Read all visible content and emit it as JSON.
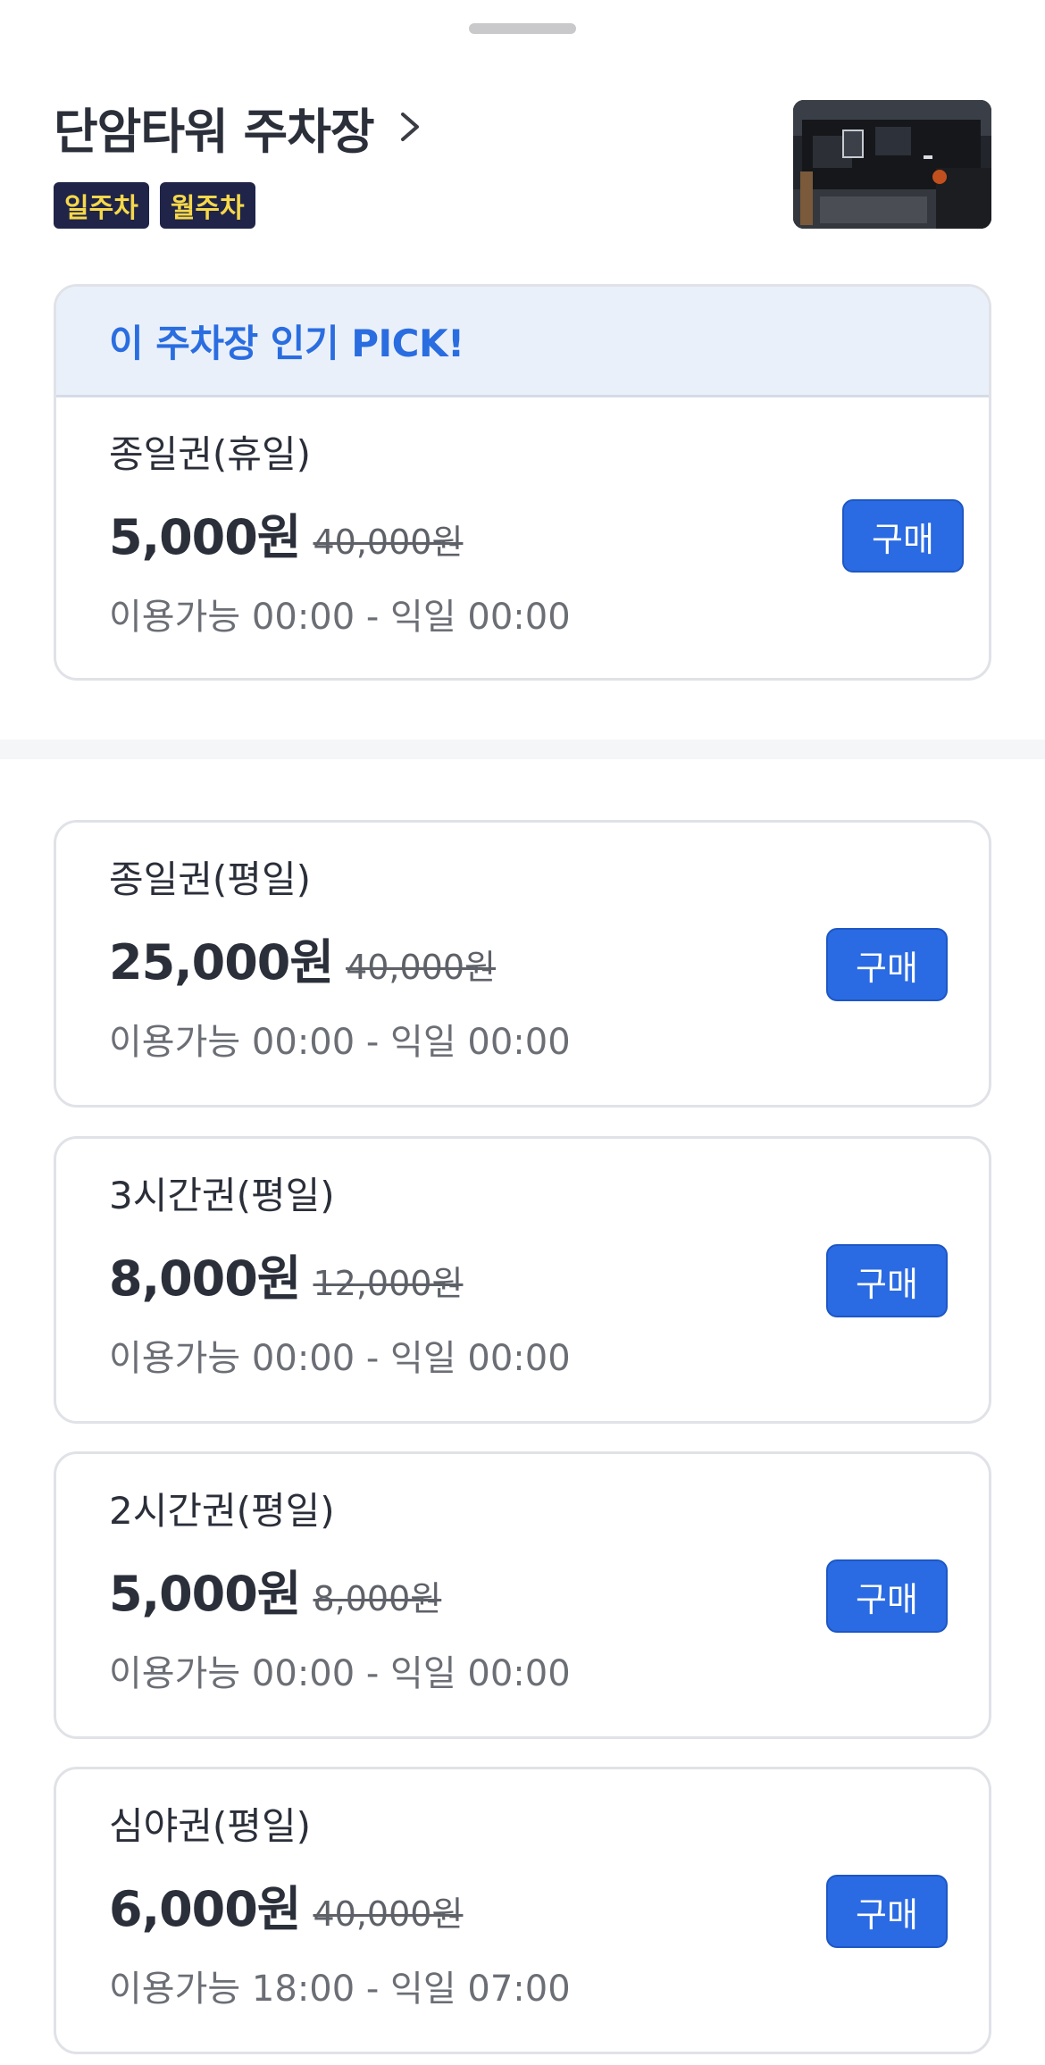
{
  "lot": {
    "title": "단암타워 주차장",
    "tags": [
      "일주차",
      "월주차"
    ]
  },
  "pick": {
    "header": "이 주차장 인기 PICK!",
    "ticket": {
      "name": "종일권(휴일)",
      "price": "5,000원",
      "original_price": "40,000원",
      "hours": "이용가능 00:00 - 익일 00:00",
      "button": "구매"
    }
  },
  "tickets": [
    {
      "name": "종일권(평일)",
      "price": "25,000원",
      "original_price": "40,000원",
      "hours": "이용가능 00:00 - 익일 00:00",
      "button": "구매"
    },
    {
      "name": "3시간권(평일)",
      "price": "8,000원",
      "original_price": "12,000원",
      "hours": "이용가능 00:00 - 익일 00:00",
      "button": "구매"
    },
    {
      "name": "2시간권(평일)",
      "price": "5,000원",
      "original_price": "8,000원",
      "hours": "이용가능 00:00 - 익일 00:00",
      "button": "구매"
    },
    {
      "name": "심야권(평일)",
      "price": "6,000원",
      "original_price": "40,000원",
      "hours": "이용가능 18:00 - 익일 07:00",
      "button": "구매"
    }
  ],
  "colors": {
    "accent": "#2a6ae2",
    "tag_bg": "#1f2448",
    "tag_text": "#f6d84a",
    "pick_bg": "#eaf0fa"
  },
  "icons": {
    "title_chevron": "chevron-right-icon"
  }
}
